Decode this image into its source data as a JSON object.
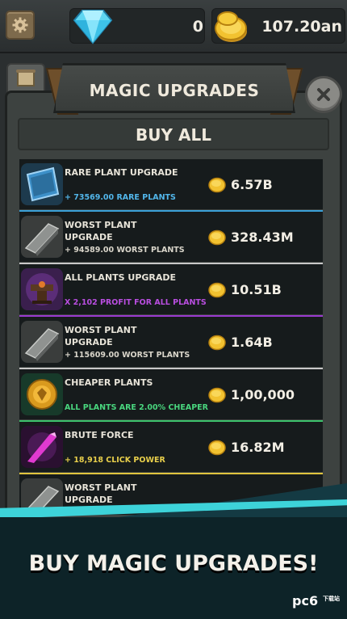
{
  "resources": {
    "gems": "0",
    "coins": "107.20an"
  },
  "panel": {
    "title": "MAGIC UPGRADES",
    "buy_all_label": "BUY ALL"
  },
  "upgrades": [
    {
      "name": "RARE PLANT UPGRADE",
      "description": "+ 73569.00 RARE PLANTS",
      "price": "6.57B",
      "icon": "blue-card-icon",
      "desc_color": "#52b6ea",
      "divider_color": "#3aa0d8"
    },
    {
      "name": "WORST PLANT UPGRADE",
      "description": "+ 94589.00 WORST PLANTS",
      "price": "328.43M",
      "icon": "gray-brick-icon",
      "desc_color": "#d9d5ca",
      "divider_color": "#c8c8c8"
    },
    {
      "name": "ALL PLANTS UPGRADE",
      "description": "X 2,102 PROFIT FOR ALL PLANTS",
      "price": "10.51B",
      "icon": "anvil-icon",
      "desc_color": "#b94ee0",
      "divider_color": "#9a3ad0"
    },
    {
      "name": "WORST PLANT UPGRADE",
      "description": "+ 115609.00 WORST PLANTS",
      "price": "1.64B",
      "icon": "gray-brick-icon",
      "desc_color": "#d9d5ca",
      "divider_color": "#c8c8c8"
    },
    {
      "name": "CHEAPER PLANTS",
      "description": "ALL PLANTS ARE 2.00% CHEAPER",
      "price": "1,00,000",
      "icon": "gold-coin-icon",
      "desc_color": "#49d67e",
      "divider_color": "#3cc26c"
    },
    {
      "name": "BRUTE FORCE",
      "description": "+ 18,918 CLICK POWER",
      "price": "16.82M",
      "icon": "crystal-icon",
      "desc_color": "#e8cf4b",
      "divider_color": "#e0c43e"
    },
    {
      "name": "WORST PLANT UPGRADE",
      "description": "",
      "price": "",
      "icon": "gray-brick-icon",
      "desc_color": "#d9d5ca",
      "divider_color": "#c8c8c8"
    }
  ],
  "promo": {
    "text": "BUY MAGIC UPGRADES!"
  },
  "watermark": {
    "brand": "pc6",
    "sub": "下载站"
  }
}
